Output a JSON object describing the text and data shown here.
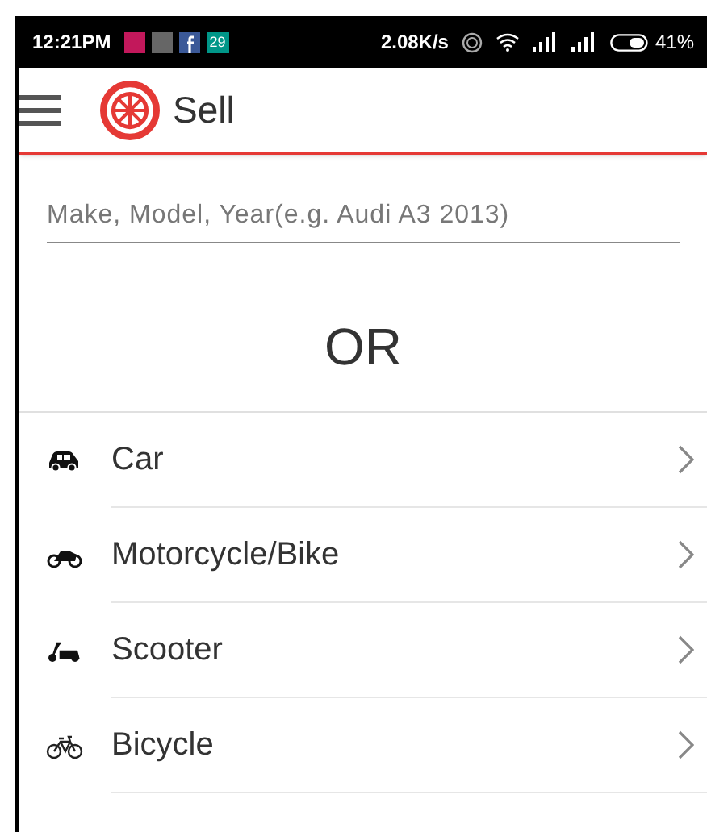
{
  "status_bar": {
    "time": "12:21PM",
    "notification_badge": "29",
    "net_speed": "2.08K/s",
    "battery": "41%"
  },
  "app_bar": {
    "title": "Sell"
  },
  "search": {
    "placeholder": "Make, Model, Year(e.g. Audi A3 2013)"
  },
  "divider_text": "OR",
  "categories": [
    {
      "kind": "car",
      "label": "Car"
    },
    {
      "kind": "motorcycle",
      "label": "Motorcycle/Bike"
    },
    {
      "kind": "scooter",
      "label": "Scooter"
    },
    {
      "kind": "bicycle",
      "label": "Bicycle"
    }
  ]
}
